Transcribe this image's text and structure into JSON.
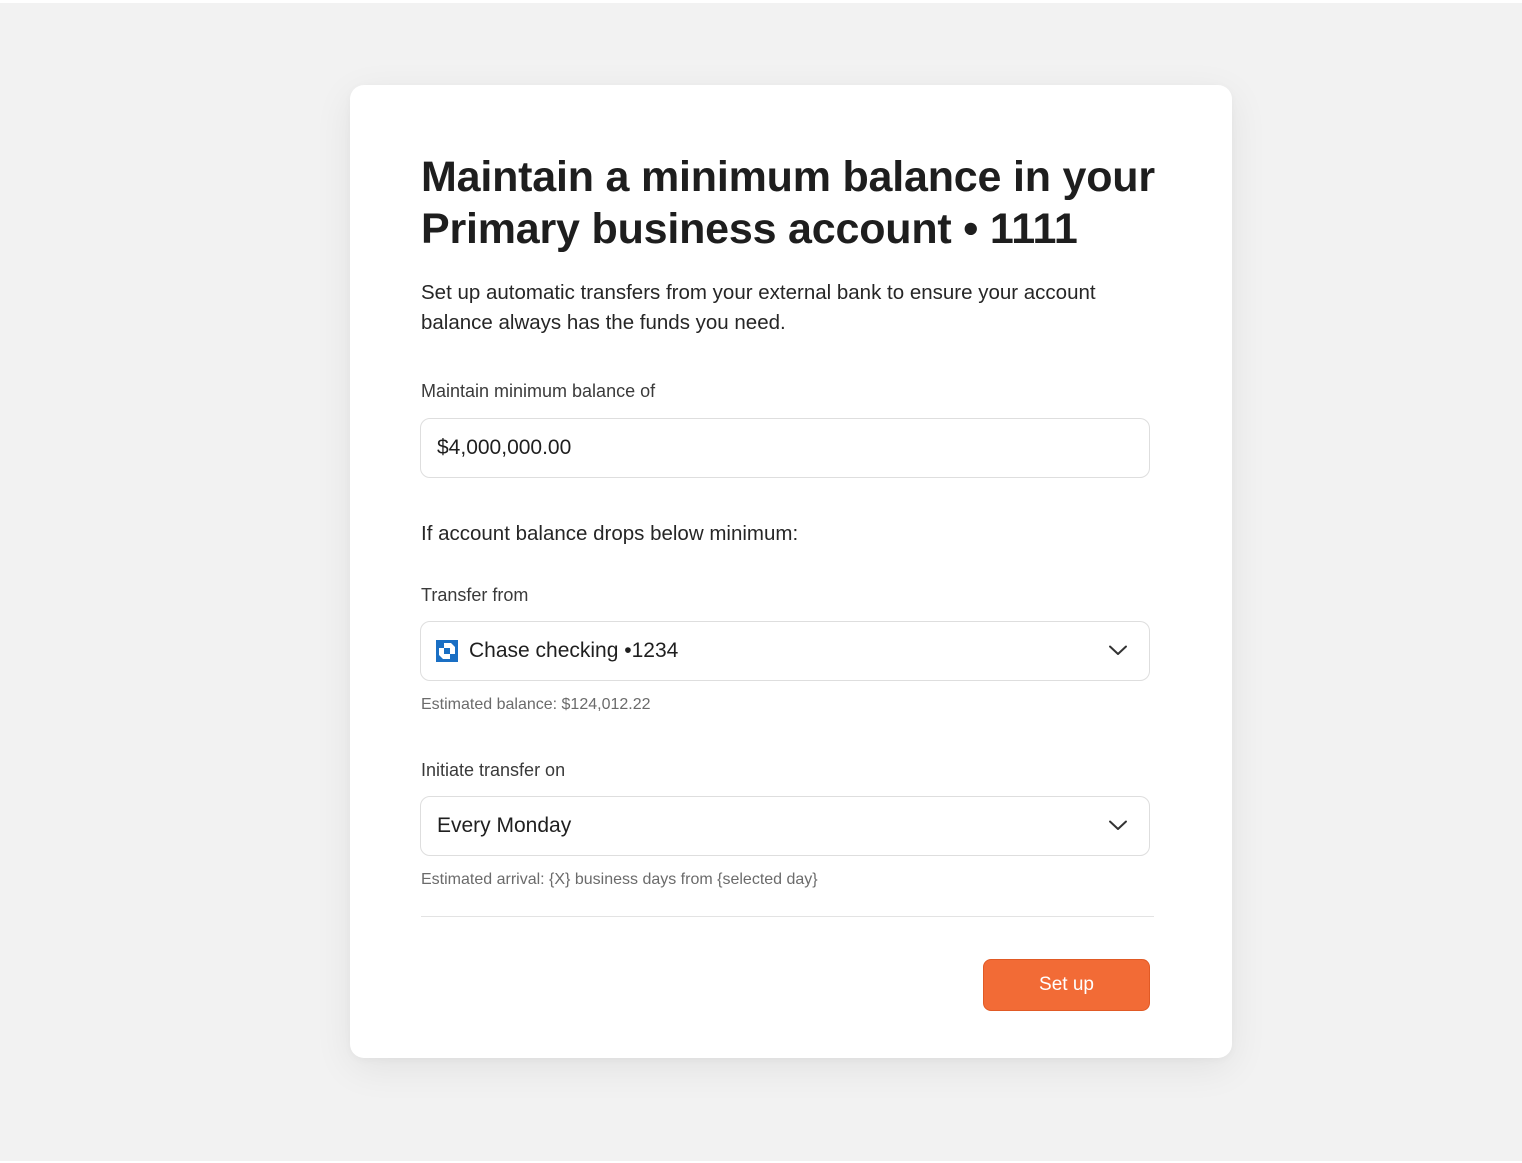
{
  "dialog": {
    "title": "Maintain a minimum balance in your Primary business account • 1111",
    "description": "Set up automatic transfers from your external bank to ensure your account balance always has the funds you need."
  },
  "min_balance": {
    "label": "Maintain minimum balance of",
    "value": "$4,000,000.00"
  },
  "condition_text": "If account balance drops below minimum:",
  "transfer_from": {
    "label": "Transfer from",
    "selected": "Chase checking •1234",
    "icon": "chase-bank-icon",
    "icon_color": "#1a6fc4",
    "hint": "Estimated balance: $124,012.22"
  },
  "initiate_on": {
    "label": "Initiate transfer on",
    "selected": "Every Monday",
    "hint": "Estimated arrival: {X} business days from {selected day}"
  },
  "actions": {
    "submit_label": "Set up",
    "submit_color": "#f26b36"
  }
}
